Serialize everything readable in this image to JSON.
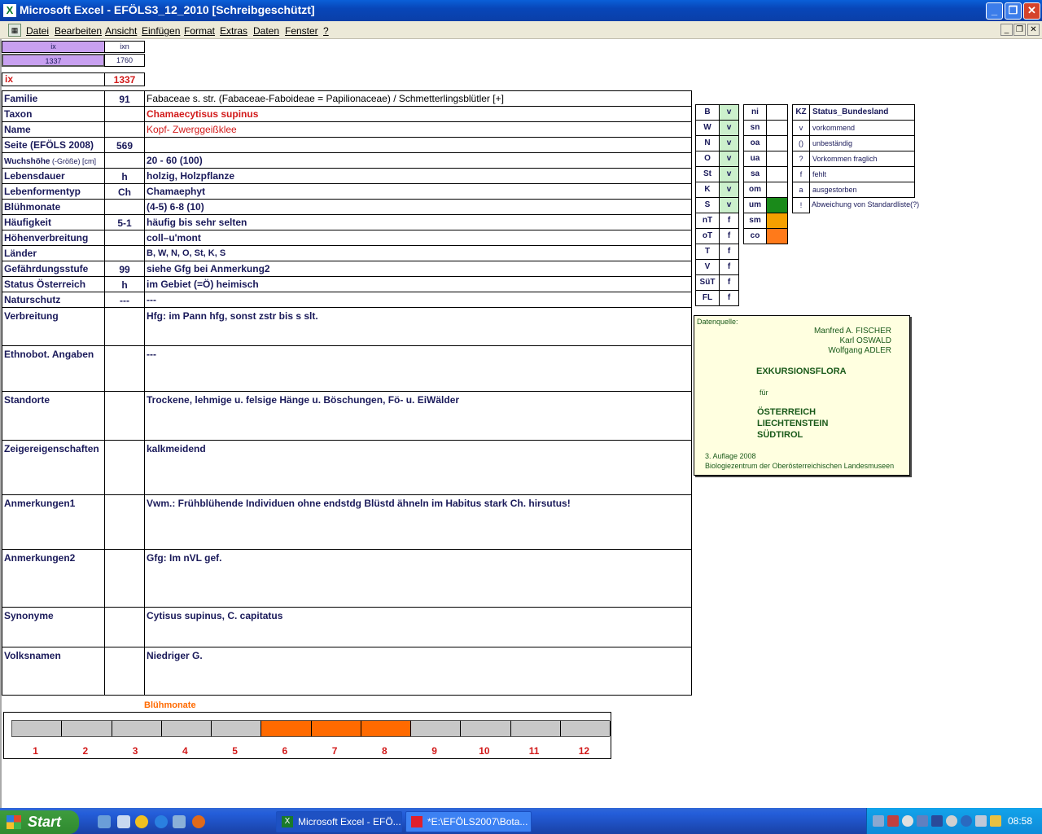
{
  "window": {
    "title": "Microsoft Excel - EFÖLS3_12_2010  [Schreibgeschützt]",
    "buttons": {
      "min": "_",
      "max": "❐",
      "close": "✕"
    }
  },
  "menubar": {
    "items": [
      "Datei",
      "Bearbeiten",
      "Ansicht",
      "Einfügen",
      "Format",
      "Extras",
      "Daten",
      "Fenster",
      "?"
    ],
    "win_buttons": [
      "_",
      "❐",
      "✕"
    ]
  },
  "header": {
    "ix_small": "ix",
    "ixn_small": "ixn",
    "ix_value": "1337",
    "ixn_value": "1760",
    "ix_label": "ix",
    "ix_main_value": "1337"
  },
  "rows": [
    {
      "label": "Familie",
      "num": "91",
      "text": "Fabaceae s. str. (Fabaceae-Faboideae = Papilionaceae)  /  Schmetterlingsblütler [+]",
      "text_style": "normal"
    },
    {
      "label": "Taxon",
      "num": "",
      "text": "Chamaecytisus supinus",
      "text_style": "red-bold"
    },
    {
      "label": "Name",
      "num": "",
      "text": "Kopf- Zwerggeißklee",
      "text_style": "red"
    },
    {
      "label": "Seite (EFÖLS 2008)",
      "num": "569",
      "text": "",
      "text_style": "bold"
    },
    {
      "label": "Wuchshöhe",
      "label_suffix": " (-Größe) [cm]",
      "num": "",
      "text": " 20 - 60 (100)",
      "text_style": "bold"
    },
    {
      "label": "Lebensdauer",
      "num": "h",
      "text": "holzig, Holzpflanze",
      "text_style": "bold"
    },
    {
      "label": "Lebenformentyp",
      "num": "Ch",
      "text": "Chamaephyt",
      "text_style": "bold"
    },
    {
      "label": "Blühmonate",
      "num": "",
      "text": "(4-5) 6-8 (10)",
      "text_style": "bold"
    },
    {
      "label": "Häufigkeit",
      "num": "5-1",
      "text": "häufig bis sehr selten",
      "text_style": "bold"
    },
    {
      "label": "Höhenverbreitung",
      "num": "",
      "text": "coll–u'mont",
      "text_style": "bold"
    },
    {
      "label": "Länder",
      "num": "",
      "text": "B, W, N, O, St, K, S",
      "text_style": "bold-small"
    },
    {
      "label": "Gefährdungsstufe",
      "num": "99",
      "text": "siehe Gfg bei Anmerkung2",
      "text_style": "bold"
    },
    {
      "label": "Status Österreich",
      "num": "h",
      "text": "im Gebiet (=Ö) heimisch",
      "text_style": "bold"
    },
    {
      "label": "Naturschutz",
      "num": "---",
      "text": "---",
      "text_style": "bold"
    },
    {
      "label": "Verbreitung",
      "num": "",
      "text": "Hfg: im Pann hfg, sonst zstr bis s slt.",
      "text_style": "bold"
    },
    {
      "label": "Ethnobot. Angaben",
      "num": "",
      "text": "---",
      "text_style": "bold"
    },
    {
      "label": "Standorte",
      "num": "",
      "text": "Trockene, lehmige u. felsige Hänge u. Böschungen, Fö- u. EiWälder",
      "text_style": "bold"
    },
    {
      "label": "Zeigereigenschaften",
      "num": "",
      "text": "kalkmeidend",
      "text_style": "bold"
    },
    {
      "label": "Anmerkungen1",
      "num": "",
      "text": "Vwm.: Frühblühende Individuen ohne endstdg Blüstd ähneln im Habitus stark Ch. hirsutus!",
      "text_style": "bold"
    },
    {
      "label": "Anmerkungen2",
      "num": "",
      "text": "Gfg:  Im nVL gef.",
      "text_style": "bold"
    },
    {
      "label": "Synonyme",
      "num": "",
      "text": "Cytisus supinus, C. capitatus",
      "text_style": "bold"
    },
    {
      "label": "Volksnamen",
      "num": "",
      "text": "Niedriger G.",
      "text_style": "bold"
    }
  ],
  "bundeslaender": [
    {
      "code": "B",
      "status": "v",
      "green": true
    },
    {
      "code": "W",
      "status": "v",
      "green": true
    },
    {
      "code": "N",
      "status": "v",
      "green": true
    },
    {
      "code": "O",
      "status": "v",
      "green": true
    },
    {
      "code": "St",
      "status": "v",
      "green": true
    },
    {
      "code": "K",
      "status": "v",
      "green": true
    },
    {
      "code": "S",
      "status": "v",
      "green": true
    },
    {
      "code": "nT",
      "status": "f",
      "green": false
    },
    {
      "code": "oT",
      "status": "f",
      "green": false
    },
    {
      "code": "T",
      "status": "f",
      "green": false
    },
    {
      "code": "V",
      "status": "f",
      "green": false
    },
    {
      "code": "SüT",
      "status": "f",
      "green": false
    },
    {
      "code": "FL",
      "status": "f",
      "green": false
    }
  ],
  "regions": [
    {
      "code": "ni",
      "color": ""
    },
    {
      "code": "sn",
      "color": ""
    },
    {
      "code": "oa",
      "color": ""
    },
    {
      "code": "ua",
      "color": ""
    },
    {
      "code": "sa",
      "color": ""
    },
    {
      "code": "om",
      "color": ""
    },
    {
      "code": "um",
      "color": "#1a8a1a"
    },
    {
      "code": "sm",
      "color": "#f5a000"
    },
    {
      "code": "co",
      "color": "#ff7a1a"
    }
  ],
  "legend": {
    "kz_header": "KZ",
    "status_header": "Status_Bundesland",
    "items": [
      {
        "kz": "v",
        "text": "vorkommend"
      },
      {
        "kz": "()",
        "text": "unbeständig"
      },
      {
        "kz": "?",
        "text": "Vorkommen fraglich"
      },
      {
        "kz": "f",
        "text": "fehlt"
      },
      {
        "kz": "a",
        "text": "ausgestorben"
      },
      {
        "kz": "!",
        "text": "Abweichung von Standardliste(?)"
      }
    ]
  },
  "datenquelle": {
    "label": "Datenquelle:",
    "authors": [
      "Manfred A. FISCHER",
      "Karl OSWALD",
      "Wolfgang ADLER"
    ],
    "title": "EXKURSIONSFLORA",
    "fuer": "für",
    "countries": [
      "ÖSTERREICH",
      "LIECHTENSTEIN",
      "SÜDTIROL"
    ],
    "edition": "3. Auflage 2008",
    "publisher": "Biologiezentrum der Oberösterreichischen Landesmuseen"
  },
  "bluehmonate_chart": {
    "title": "Blühmonate",
    "months": [
      "1",
      "2",
      "3",
      "4",
      "5",
      "6",
      "7",
      "8",
      "9",
      "10",
      "11",
      "12"
    ],
    "flowering": [
      false,
      false,
      false,
      false,
      false,
      true,
      true,
      true,
      false,
      false,
      false,
      false
    ],
    "color_on": "#ff6a00",
    "color_off": "#c8c8c8"
  },
  "taskbar": {
    "start": "Start",
    "tasks": [
      {
        "label": "Microsoft Excel - EFÖ...",
        "active": true
      },
      {
        "label": "*E:\\EFÖLS2007\\Bota...",
        "active": false
      }
    ],
    "clock": "08:58"
  }
}
